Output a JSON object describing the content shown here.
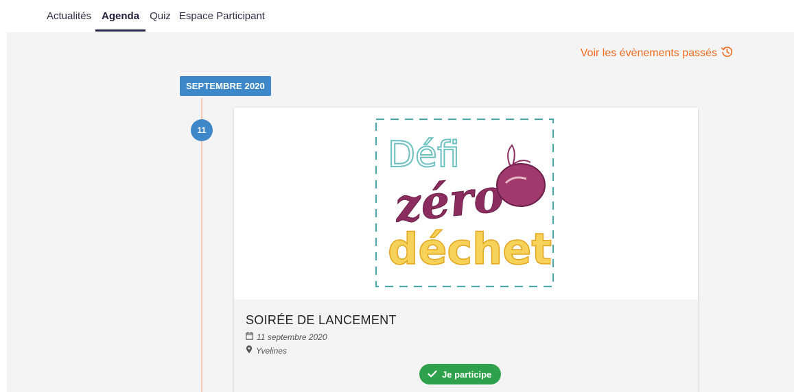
{
  "tabs": [
    {
      "label": "Actualités",
      "active": false
    },
    {
      "label": "Agenda",
      "active": true
    },
    {
      "label": "Quiz",
      "active": false
    },
    {
      "label": "Espace Participant",
      "active": false
    }
  ],
  "past_events_link": {
    "label": "Voir les évènements passés",
    "icon": "history-icon"
  },
  "timeline": {
    "month": "SEPTEMBRE 2020",
    "day": "11"
  },
  "event": {
    "logo": {
      "line1": "Défi",
      "line2": "zéro",
      "line3": "déchet",
      "icon": "apple-icon"
    },
    "title": "SOIRÉE DE LANCEMENT",
    "date": "11 septembre 2020",
    "location": "Yvelines",
    "participate_label": "Je participe"
  },
  "colors": {
    "accent_orange": "#f06b21",
    "timeline_blue": "#3e88c9",
    "participate_green": "#2fa04b",
    "logo_teal": "#5fb8b9",
    "logo_purple": "#8b2d5e",
    "logo_yellow": "#f4c22b"
  }
}
